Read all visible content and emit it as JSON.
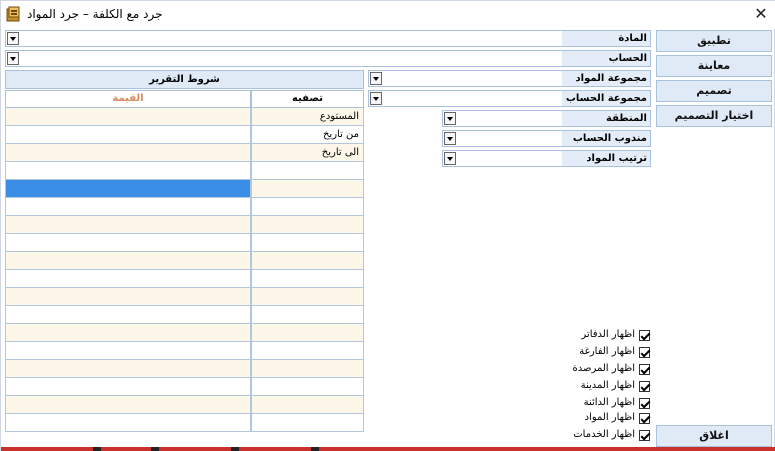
{
  "window": {
    "title": "جرد مع الكلفة – جرد المواد",
    "close_glyph": "✕"
  },
  "buttons": {
    "apply": "تطبيق",
    "preview": "معاينة",
    "design": "تصميم",
    "choose_design": "اختيار التصميم",
    "close": "اغلاق"
  },
  "fields": {
    "material": "المادة",
    "account": "الحساب",
    "material_group": "مجموعة المواد",
    "account_group": "مجموعة الحساب",
    "region": "المنطقة",
    "account_rep": "مندوب الحساب",
    "material_order": "ترتيب المواد"
  },
  "grid": {
    "title": "شروط التقرير",
    "col_value": "القيمة",
    "col_filter": "تصفيه",
    "rows": [
      {
        "filter": "المستودع"
      },
      {
        "filter": "من تاريخ"
      },
      {
        "filter": "الى تاريخ"
      },
      {
        "filter": ""
      },
      {
        "filter": ""
      },
      {
        "filter": ""
      },
      {
        "filter": ""
      },
      {
        "filter": ""
      },
      {
        "filter": ""
      },
      {
        "filter": ""
      },
      {
        "filter": ""
      },
      {
        "filter": ""
      },
      {
        "filter": ""
      },
      {
        "filter": ""
      },
      {
        "filter": ""
      },
      {
        "filter": ""
      },
      {
        "filter": ""
      },
      {
        "filter": ""
      }
    ]
  },
  "options": {
    "show_ledgers": "اظهار الدفاتر",
    "show_empty": "اظهار الفارغة",
    "show_balanced": "اظهار المرصدة",
    "show_debit": "اظهار المدينة",
    "show_credit": "اظهار الدائنة",
    "show_materials": "اظهار المواد",
    "show_services": "اظهار الخدمات"
  },
  "colors": {
    "selection": "#3a8ee6",
    "value_header": "#d98b5f",
    "row_alt": "#fdf7ea",
    "button_bg": "#dfeaf6"
  }
}
